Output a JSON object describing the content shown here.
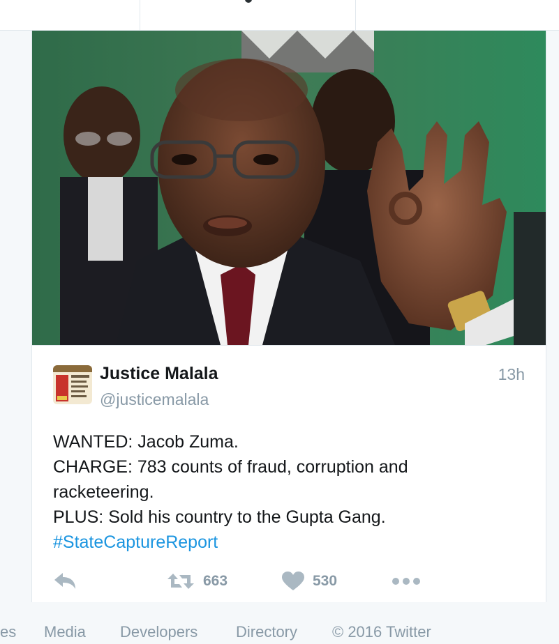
{
  "header": {
    "tab_label": ""
  },
  "tweet": {
    "author_name": "Justice Malala",
    "author_handle": "@justicemalala",
    "timestamp": "13h",
    "lines": [
      "WANTED: Jacob Zuma.",
      "CHARGE: 783 counts of fraud, corruption and",
      "racketeering.",
      "PLUS: Sold his country to the Gupta Gang."
    ],
    "hashtag": "#StateCaptureReport",
    "avatar_text": "We have ...MALALA",
    "retweet_count": "663",
    "like_count": "530",
    "icons": {
      "reply": "reply-icon",
      "retweet": "retweet-icon",
      "like": "heart-icon",
      "more": "more-dots-icon"
    }
  },
  "footer": {
    "links": [
      "es",
      "Media",
      "Developers",
      "Directory",
      "© 2016 Twitter"
    ]
  },
  "colors": {
    "link": "#1b95e0",
    "muted": "#8899a6",
    "text": "#14171a",
    "background": "#f5f8fa"
  }
}
